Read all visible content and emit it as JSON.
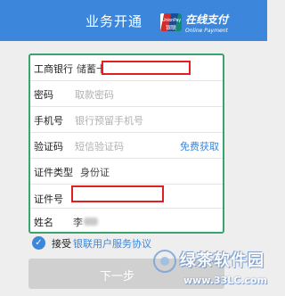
{
  "header": {
    "title": "业务开通",
    "brand_main": "在线支付",
    "brand_sub": "Online Payment",
    "logo_text_top": "UnionPay",
    "logo_text_bottom": "银联"
  },
  "form": {
    "bank_label": "工商银行",
    "card_type": "储蓄卡",
    "password_label": "密码",
    "password_placeholder": "取款密码",
    "phone_label": "手机号",
    "phone_placeholder": "银行预留手机号",
    "code_label": "验证码",
    "code_placeholder": "短信验证码",
    "code_link": "免费获取",
    "id_type_label": "证件类型",
    "id_type_value": "身份证",
    "id_number_label": "证件号",
    "name_label": "姓名",
    "name_value": "李"
  },
  "agreement": {
    "prefix": "接受",
    "link": "银联用户服务协议"
  },
  "next_button": {
    "label": "下一步"
  },
  "watermark": {
    "title": "绿茶软件园",
    "url": "www.33LC.com"
  },
  "colors": {
    "header": "#3c87dc",
    "highlight_border": "#3aa46e",
    "redaction_border": "#e02020",
    "link": "#3c87dc"
  }
}
